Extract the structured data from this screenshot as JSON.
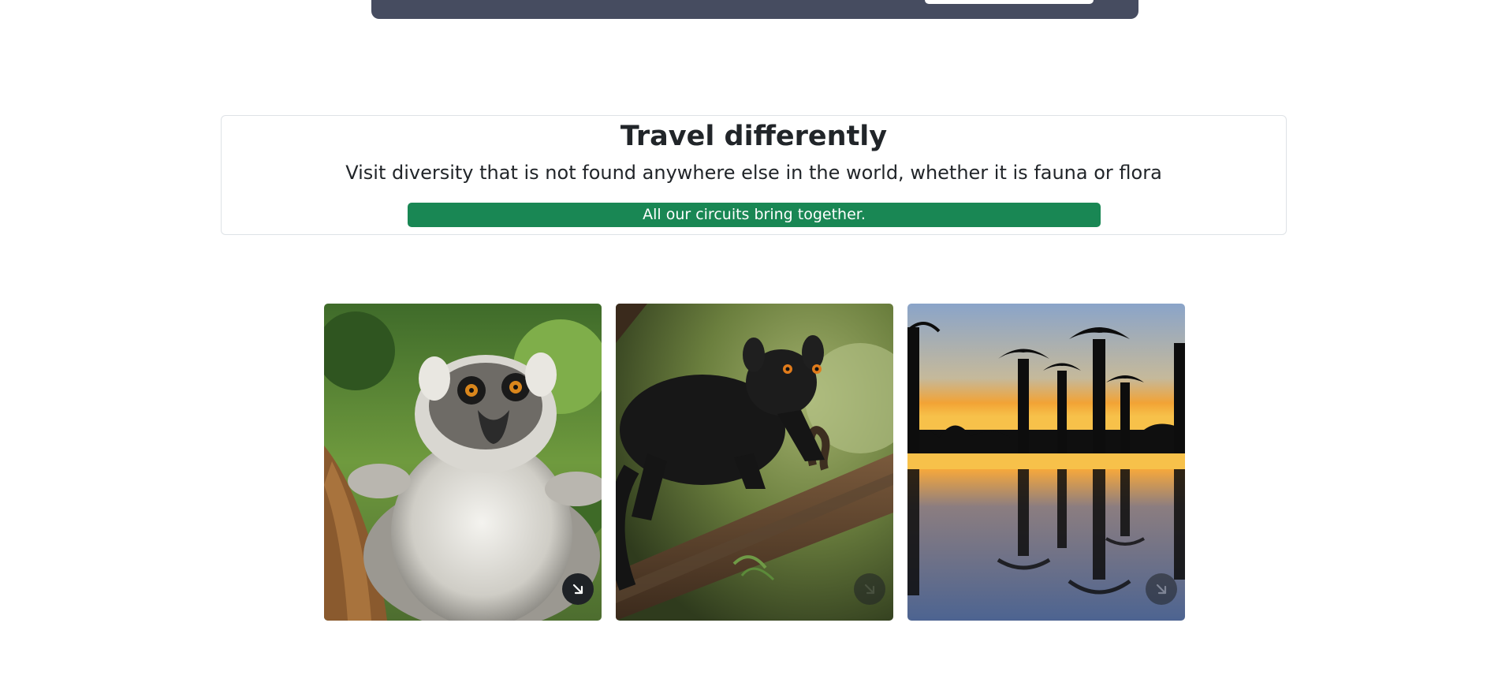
{
  "hero": {
    "title": "Travel differently",
    "subtitle": "Visit diversity that is not found anywhere else in the world, whether it is fauna or flora",
    "banner": "All our circuits bring together."
  },
  "gallery": {
    "items": [
      {
        "subject": "ring-tailed lemur",
        "icon": "arrow-down-right-icon"
      },
      {
        "subject": "black lemur on branch",
        "icon": "arrow-down-right-icon"
      },
      {
        "subject": "baobab trees at sunset",
        "icon": "arrow-down-right-icon"
      }
    ]
  },
  "colors": {
    "top_bar": "#464c60",
    "banner": "#198754",
    "button_dark": "#1f2226"
  }
}
